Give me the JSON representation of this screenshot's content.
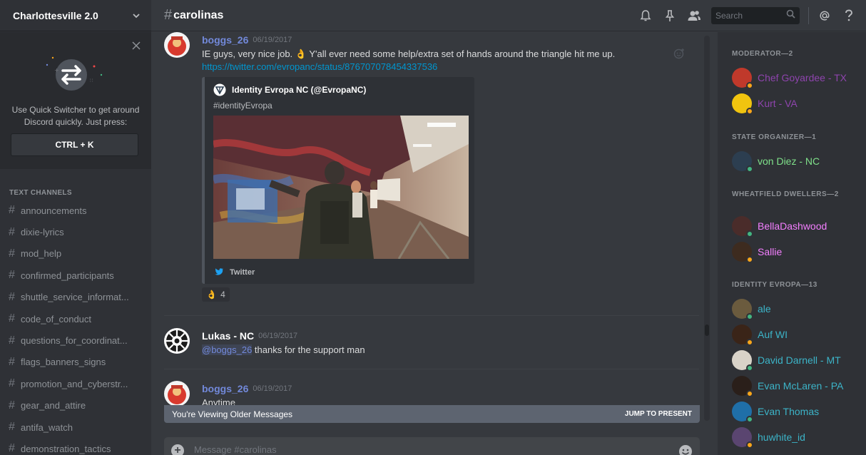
{
  "server": {
    "name": "Charlottesville 2.0"
  },
  "switcher": {
    "text_line1": "Use Quick Switcher to get around",
    "text_line2": "Discord quickly. Just press:",
    "shortcut": "CTRL + K"
  },
  "channels": {
    "title": "TEXT CHANNELS",
    "items": [
      {
        "hash": "#",
        "label": "announcements"
      },
      {
        "hash": "#",
        "label": "dixie-lyrics"
      },
      {
        "hash": "#",
        "label": "mod_help"
      },
      {
        "hash": "#",
        "label": "confirmed_participants"
      },
      {
        "hash": "#",
        "label": "shuttle_service_informat..."
      },
      {
        "hash": "#",
        "label": "code_of_conduct"
      },
      {
        "hash": "#",
        "label": "questions_for_coordinat..."
      },
      {
        "hash": "#",
        "label": "flags_banners_signs"
      },
      {
        "hash": "#",
        "label": "promotion_and_cyberstr..."
      },
      {
        "hash": "#",
        "label": "gear_and_attire"
      },
      {
        "hash": "#",
        "label": "antifa_watch"
      },
      {
        "hash": "#",
        "label": "demonstration_tactics"
      }
    ]
  },
  "header": {
    "hash": "#",
    "channel": "carolinas",
    "search_placeholder": "Search"
  },
  "messages": [
    {
      "author": "boggs_26",
      "timestamp": "06/19/2017",
      "text": "IE guys, very nice job. 👌 Y'all ever need some help/extra set of hands around the triangle hit me up.",
      "link": "https://twitter.com/evropanc/status/876707078454337536",
      "embed": {
        "author": "Identity Evropa NC (@EvropaNC)",
        "description": "#identityEvropa",
        "footer": "Twitter"
      },
      "reaction": {
        "emoji": "👌",
        "count": "4"
      }
    },
    {
      "author": "Lukas - NC",
      "timestamp": "06/19/2017",
      "mention": "@boggs_26",
      "text": " thanks for the support man"
    },
    {
      "author": "boggs_26",
      "timestamp": "06/19/2017",
      "text": "Anytime"
    }
  ],
  "older_bar": {
    "text": "You're Viewing Older Messages",
    "jump": "JUMP TO PRESENT"
  },
  "composer": {
    "placeholder": "Message #carolinas",
    "plus": "+"
  },
  "members": {
    "groups": [
      {
        "title": "MODERATOR—2",
        "items": [
          {
            "name": "Chef Goyardee - TX",
            "color": "#8e44ad",
            "status": "#faa61a"
          },
          {
            "name": "Kurt - VA",
            "color": "#8e44ad",
            "status": "#faa61a"
          }
        ]
      },
      {
        "title": "STATE ORGANIZER—1",
        "items": [
          {
            "name": "von Diez - NC",
            "color": "#7fe08a",
            "status": "#43b581"
          }
        ]
      },
      {
        "title": "WHEATFIELD DWELLERS—2",
        "items": [
          {
            "name": "BellaDashwood",
            "color": "#f47fff",
            "status": "#43b581"
          },
          {
            "name": "Sallie",
            "color": "#f47fff",
            "status": "#faa61a"
          }
        ]
      },
      {
        "title": "IDENTITY EVROPA—13",
        "items": [
          {
            "name": "ale",
            "color": "#3cb4c8",
            "status": "#43b581"
          },
          {
            "name": "Auf WI",
            "color": "#3cb4c8",
            "status": "#faa61a"
          },
          {
            "name": "David Darnell - MT",
            "color": "#3cb4c8",
            "status": "#43b581"
          },
          {
            "name": "Evan McLaren - PA",
            "color": "#3cb4c8",
            "status": "#faa61a"
          },
          {
            "name": "Evan Thomas",
            "color": "#3cb4c8",
            "status": "#43b581"
          },
          {
            "name": "huwhite_id",
            "color": "#3cb4c8",
            "status": "#faa61a"
          }
        ]
      }
    ]
  }
}
